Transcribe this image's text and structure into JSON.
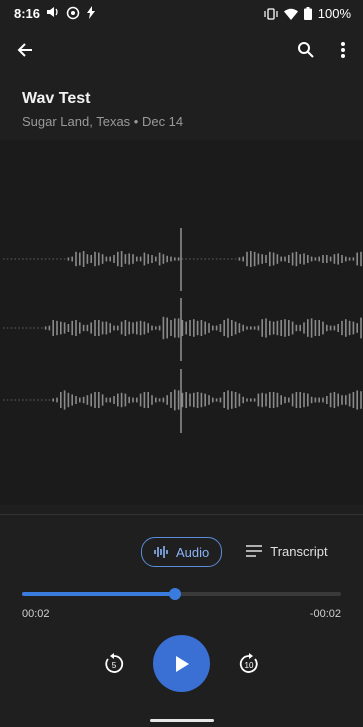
{
  "statusbar": {
    "time": "8:16",
    "battery": "100%"
  },
  "recording": {
    "title": "Wav Test",
    "subtitle": "Sugar Land, Texas • Dec 14"
  },
  "tabs": {
    "audio": "Audio",
    "transcript": "Transcript"
  },
  "player": {
    "elapsed": "00:02",
    "remaining": "-00:02",
    "progress_percent": 48,
    "skip_back_label": "5",
    "skip_forward_label": "10"
  }
}
